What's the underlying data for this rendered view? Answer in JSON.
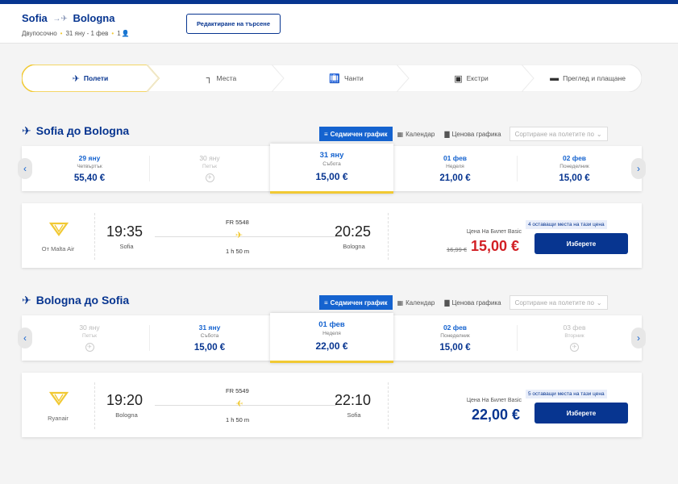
{
  "header": {
    "origin": "Sofia",
    "destination": "Bologna",
    "trip_type": "Двупосочно",
    "dates": "31 яну - 1 фев",
    "passengers": "1",
    "edit_label": "Редактиране на търсене"
  },
  "steps": [
    {
      "label": "Полети",
      "icon": "plane-icon",
      "active": true
    },
    {
      "label": "Места",
      "icon": "seat-icon",
      "active": false
    },
    {
      "label": "Чанти",
      "icon": "bag-icon",
      "active": false
    },
    {
      "label": "Екстри",
      "icon": "extras-icon",
      "active": false
    },
    {
      "label": "Преглед и плащане",
      "icon": "card-icon",
      "active": false
    }
  ],
  "view_tabs": {
    "weekly": "Седмичен график",
    "calendar": "Календар",
    "price_chart": "Ценова графика",
    "sort": "Сортиране на полетите по"
  },
  "outbound": {
    "title": "Sofia до Bologna",
    "dates": [
      {
        "date": "29 яну",
        "weekday": "Четвъртък",
        "price": "55,40 €",
        "available": true
      },
      {
        "date": "30 яну",
        "weekday": "Петък",
        "price": "",
        "available": false
      },
      {
        "date": "31 яну",
        "weekday": "Събота",
        "price": "15,00 €",
        "available": true,
        "selected": true
      },
      {
        "date": "01 фев",
        "weekday": "Неделя",
        "price": "21,00 €",
        "available": true
      },
      {
        "date": "02 фев",
        "weekday": "Понеделник",
        "price": "15,00 €",
        "available": true
      }
    ],
    "flight": {
      "operator": "От Malta Air",
      "depart_time": "19:35",
      "depart_city": "Sofia",
      "flight_number": "FR 5548",
      "duration": "1 h 50 m",
      "arrive_time": "20:25",
      "arrive_city": "Bologna",
      "fare_label": "Цена На Билет Basic",
      "old_price": "16,99 €",
      "price": "15,00 €",
      "seats_left": "4 оставащи места на тази цена",
      "select_label": "Изберете"
    }
  },
  "inbound": {
    "title": "Bologna до Sofia",
    "dates": [
      {
        "date": "30 яну",
        "weekday": "Петък",
        "price": "",
        "available": false
      },
      {
        "date": "31 яну",
        "weekday": "Събота",
        "price": "15,00 €",
        "available": true
      },
      {
        "date": "01 фев",
        "weekday": "Неделя",
        "price": "22,00 €",
        "available": true,
        "selected": true
      },
      {
        "date": "02 фев",
        "weekday": "Понеделник",
        "price": "15,00 €",
        "available": true
      },
      {
        "date": "03 фев",
        "weekday": "Вторник",
        "price": "",
        "available": false
      }
    ],
    "flight": {
      "operator": "Ryanair",
      "depart_time": "19:20",
      "depart_city": "Bologna",
      "flight_number": "FR 5549",
      "duration": "1 h 50 m",
      "arrive_time": "22:10",
      "arrive_city": "Sofia",
      "fare_label": "Цена На Билет Basic",
      "price": "22,00 €",
      "seats_left": "5 оставащи места на тази цена",
      "select_label": "Изберете"
    }
  },
  "colors": {
    "brand_blue": "#073590",
    "accent_blue": "#1563cf",
    "yellow": "#f1c933",
    "sale_red": "#d22025"
  }
}
